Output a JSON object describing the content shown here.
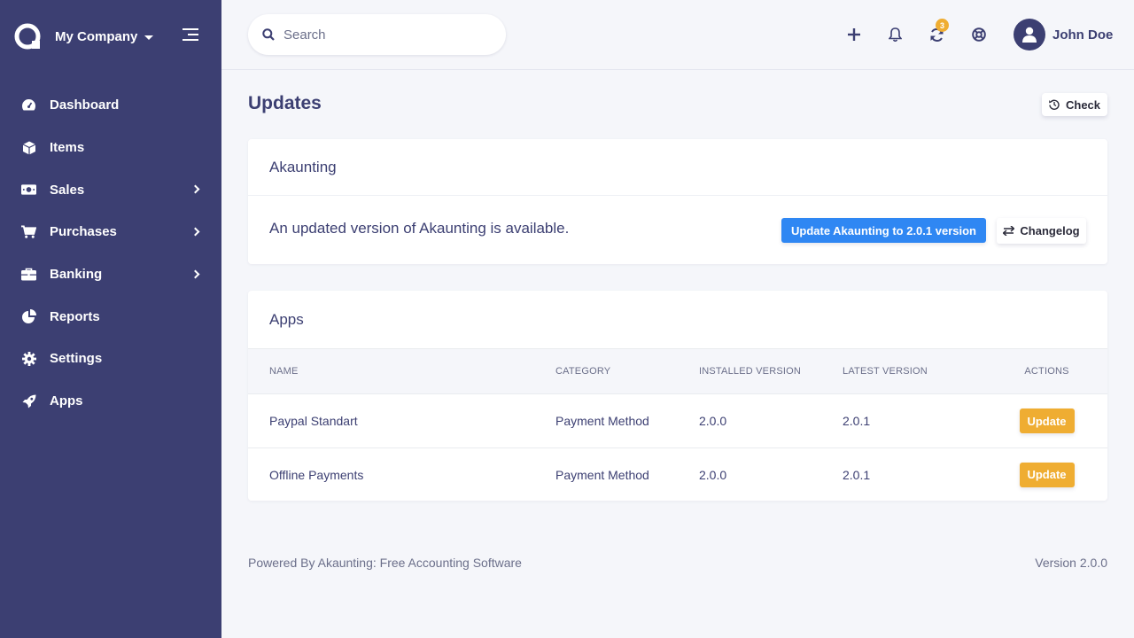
{
  "sidebar": {
    "company": "My Company",
    "items": [
      {
        "label": "Dashboard",
        "icon": "tachometer-icon"
      },
      {
        "label": "Items",
        "icon": "cube-icon"
      },
      {
        "label": "Sales",
        "icon": "money-icon",
        "has_submenu": true
      },
      {
        "label": "Purchases",
        "icon": "shopping-cart-icon",
        "has_submenu": true
      },
      {
        "label": "Banking",
        "icon": "briefcase-icon",
        "has_submenu": true
      },
      {
        "label": "Reports",
        "icon": "chart-pie-icon"
      },
      {
        "label": "Settings",
        "icon": "cog-icon"
      },
      {
        "label": "Apps",
        "icon": "rocket-icon"
      }
    ]
  },
  "header": {
    "search_placeholder": "Search",
    "updates_badge": "3",
    "user_name": "John Doe"
  },
  "page": {
    "title": "Updates",
    "check_label": "Check"
  },
  "core_update": {
    "title": "Akaunting",
    "message": "An updated version of Akaunting is available.",
    "update_label": "Update Akaunting to 2.0.1 version",
    "changelog_label": "Changelog"
  },
  "apps": {
    "title": "Apps",
    "columns": [
      "NAME",
      "CATEGORY",
      "INSTALLED VERSION",
      "LATEST VERSION",
      "ACTIONS"
    ],
    "rows": [
      {
        "name": "Paypal Standart",
        "category": "Payment Method",
        "installed": "2.0.0",
        "latest": "2.0.1",
        "action": "Update"
      },
      {
        "name": "Offline Payments",
        "category": "Payment Method",
        "installed": "2.0.0",
        "latest": "2.0.1",
        "action": "Update"
      }
    ]
  },
  "footer": {
    "powered_by": "Powered By Akaunting: Free Accounting Software",
    "version": "Version 2.0.0"
  },
  "colors": {
    "sidebar_bg": "#3c3f72",
    "primary": "#2f87f3",
    "warning": "#efad32",
    "page_bg": "#f5f6fa"
  }
}
